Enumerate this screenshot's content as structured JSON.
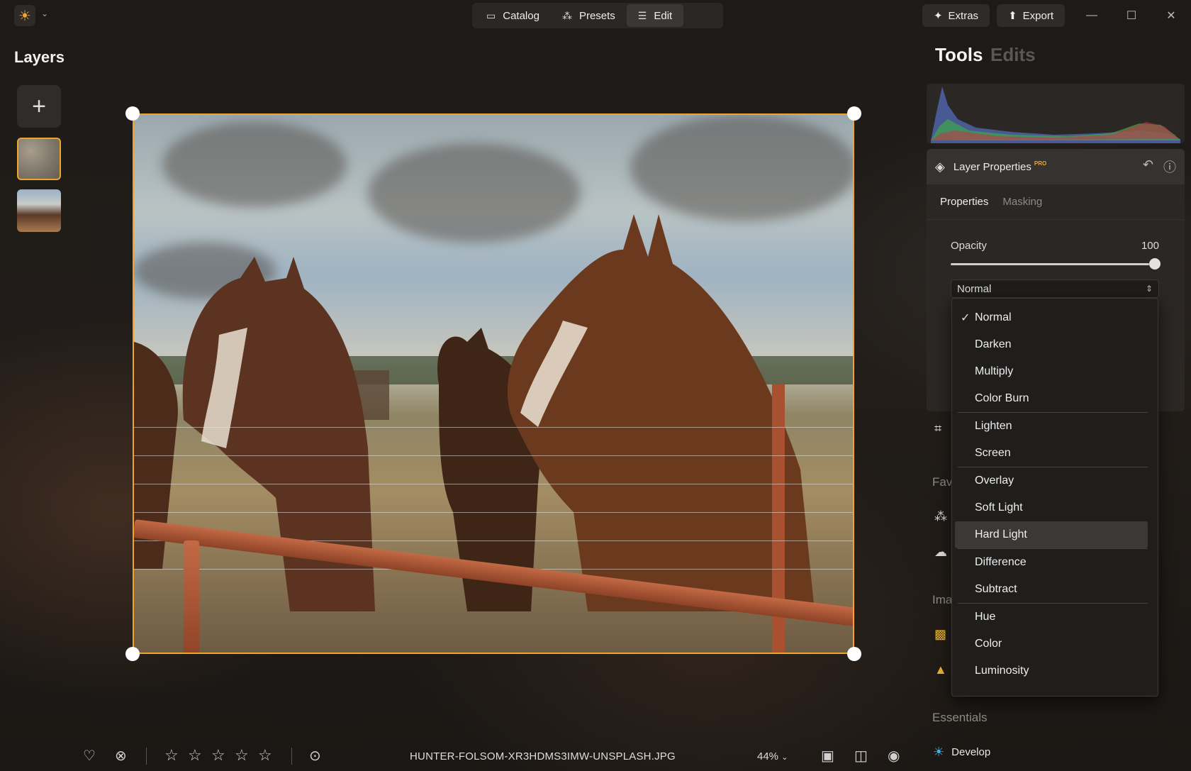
{
  "topbar": {
    "modes": [
      "Catalog",
      "Presets",
      "Edit"
    ],
    "active_mode": "Edit",
    "extras_label": "Extras",
    "export_label": "Export"
  },
  "layers": {
    "title": "Layers"
  },
  "right_panel": {
    "tabs": [
      "Tools",
      "Edits"
    ],
    "active_tab": "Tools",
    "layer_properties": {
      "title": "Layer Properties",
      "badge": "PRO",
      "tabs": [
        "Properties",
        "Masking"
      ],
      "opacity_label": "Opacity",
      "opacity_value": "100",
      "blend_mode": "Normal"
    },
    "favorites_label": "Fav",
    "image_label": "Ima",
    "essentials_label": "Essentials",
    "develop_label": "Develop"
  },
  "blend_dropdown": {
    "groups": [
      [
        "Normal",
        "Darken",
        "Multiply",
        "Color Burn"
      ],
      [
        "Lighten",
        "Screen"
      ],
      [
        "Overlay",
        "Soft Light",
        "Hard Light"
      ],
      [
        "Difference",
        "Subtract"
      ],
      [
        "Hue",
        "Color",
        "Luminosity"
      ]
    ],
    "checked": "Normal",
    "highlighted": "Hard Light"
  },
  "bottombar": {
    "filename": "HUNTER-FOLSOM-XR3HDMS3IMW-UNSPLASH.JPG",
    "zoom": "44%",
    "rating_stars": 5
  },
  "colors": {
    "accent": "#f0a42c",
    "develop_icon": "#35b4f0"
  }
}
